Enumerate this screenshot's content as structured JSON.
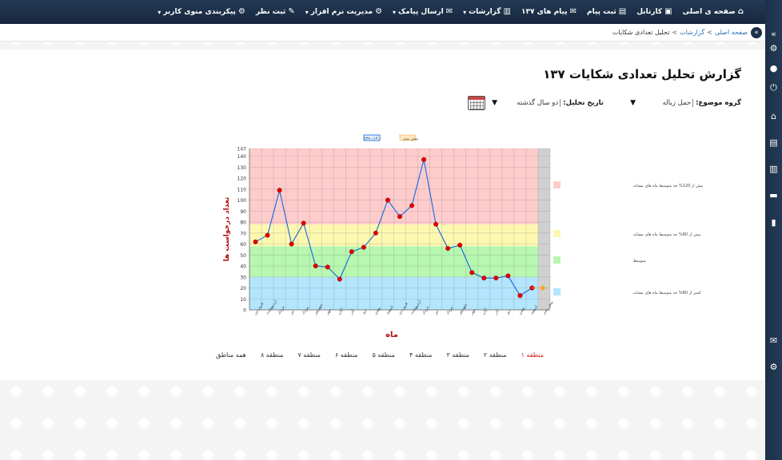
{
  "nav": {
    "items": [
      {
        "label": "صفحه ی اصلی",
        "icon": "home-icon",
        "glyph": "⌂",
        "dropdown": false
      },
      {
        "label": "کارتابل",
        "icon": "inbox-icon",
        "glyph": "▣",
        "dropdown": false
      },
      {
        "label": "ثبت پیام",
        "icon": "form-icon",
        "glyph": "▤",
        "dropdown": false
      },
      {
        "label": "پیام های ۱۳۷",
        "icon": "messages-icon",
        "glyph": "✉",
        "dropdown": false
      },
      {
        "label": "گزارشات",
        "icon": "report-icon",
        "glyph": "▥",
        "dropdown": true
      },
      {
        "label": "ارسال پیامک",
        "icon": "envelope-icon",
        "glyph": "✉",
        "dropdown": true
      },
      {
        "label": "مدیریت نرم افزار",
        "icon": "settings-icon",
        "glyph": "⚙",
        "dropdown": true
      },
      {
        "label": "ثبت نظر",
        "icon": "comment-icon",
        "glyph": "✎",
        "dropdown": false
      },
      {
        "label": "پیکربندی منوی کاربر",
        "icon": "gear-icon",
        "glyph": "⚙",
        "dropdown": true
      }
    ]
  },
  "sidebar": {
    "icons": [
      {
        "name": "collapse-chevron-icon",
        "glyph": "»",
        "top": 0
      },
      {
        "name": "settings-icon",
        "glyph": "⚙"
      },
      {
        "name": "user-icon",
        "glyph": "●"
      },
      {
        "name": "power-icon",
        "glyph": "⏻"
      },
      {
        "name": "home-icon",
        "glyph": "⌂"
      },
      {
        "name": "report-doc-icon",
        "glyph": "▤"
      },
      {
        "name": "document-icon",
        "glyph": "▥"
      },
      {
        "name": "truck-icon",
        "glyph": "▬"
      },
      {
        "name": "bar-chart-icon",
        "glyph": "▮"
      },
      {
        "name": "envelope-icon",
        "glyph": "✉"
      },
      {
        "name": "cog-icon",
        "glyph": "⚙"
      }
    ]
  },
  "breadcrumb": {
    "items": [
      "صفحه اصلی",
      "گزارشات",
      "تحلیل تعدادی شکایات"
    ],
    "separator": ">"
  },
  "page": {
    "title": "گزارش تحلیل تعدادی شکایات ۱۳۷"
  },
  "filters": {
    "subject_label": "گروه موضوع:",
    "subject_value": "حمل زباله",
    "date_label": "تاریخ تحلیل:",
    "date_value": "دو سال گذشته"
  },
  "chart_data": {
    "type": "line",
    "title": "",
    "xlabel": "ماه",
    "ylabel": "تعداد درخواست ها",
    "ylim": [
      0,
      147
    ],
    "yticks": [
      0,
      10,
      20,
      30,
      40,
      50,
      60,
      70,
      80,
      90,
      100,
      110,
      120,
      130,
      140,
      147
    ],
    "categories": [
      "فروردین",
      "اردیبهشت",
      "خرداد",
      "تیر",
      "مرداد",
      "شهریور",
      "مهر",
      "آبان",
      "آذر",
      "دی",
      "بهمن",
      "اسفند",
      "فروردین",
      "اردیبهشت",
      "خرداد",
      "تیر",
      "مرداد",
      "شهریور",
      "مهر",
      "آبان",
      "آذر",
      "دی",
      "بهمن",
      "اسفند",
      "پیش بینی"
    ],
    "series": [
      {
        "name": "۱۳۹۰-۱۴۰۰",
        "color": "#1565e0",
        "marker_color": "#e00000",
        "values": [
          62,
          68,
          109,
          60,
          79,
          40,
          39,
          28,
          53,
          57,
          70,
          100,
          85,
          95,
          137,
          78,
          56,
          59,
          34,
          29,
          29,
          31,
          13,
          20
        ]
      },
      {
        "name": "پیش بینی",
        "color": "#f5a623",
        "values": [
          20,
          20
        ]
      }
    ],
    "bands": [
      {
        "from": 0,
        "to": 30,
        "color": "#b3e5fc",
        "label": "کمتر از 60% حد متوسط ماه های مشابه"
      },
      {
        "from": 30,
        "to": 58,
        "color": "#b7f7b0",
        "label": "متوسط"
      },
      {
        "from": 58,
        "to": 78,
        "color": "#fdf8b0",
        "label": "بیش از 60% حد متوسط ماه های مشابه"
      },
      {
        "from": 78,
        "to": 147,
        "color": "#ffcccc",
        "label": "بیش از 120% حد متوسط ماه های مشابه"
      }
    ],
    "legend": {
      "placement": "top",
      "entries": [
        "۱۳۹۰-۱۴۰۰",
        "پیش بینی"
      ]
    },
    "grid": true
  },
  "regions": {
    "tabs": [
      "منطقه ۱",
      "منطقه ۲",
      "منطقه ۳",
      "منطقه ۴",
      "منطقه ۵",
      "منطقه ۶",
      "منطقه ۷",
      "منطقه ۸",
      "همه مناطق"
    ],
    "active_index": 0
  }
}
